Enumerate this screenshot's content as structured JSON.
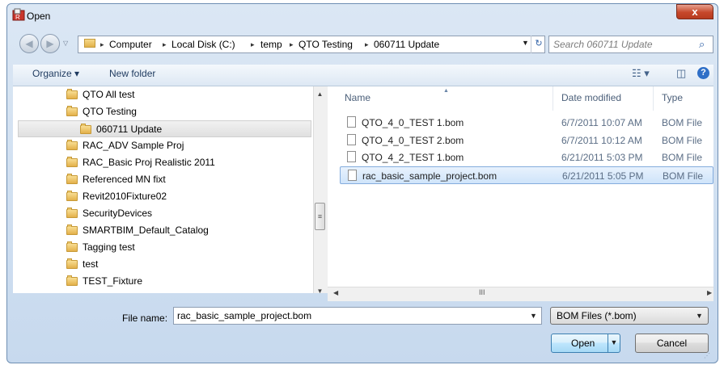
{
  "window": {
    "title": "Open",
    "close_label": "x"
  },
  "address": {
    "crumbs": [
      "Computer",
      "Local Disk (C:)",
      "temp",
      "QTO Testing",
      "060711 Update"
    ],
    "separator": "▸"
  },
  "search": {
    "placeholder": "Search 060711 Update"
  },
  "toolbar": {
    "organize": "Organize ▾",
    "new_folder": "New folder"
  },
  "tree": {
    "items": [
      {
        "label": "QTO All test",
        "selected": false
      },
      {
        "label": "QTO Testing",
        "selected": false
      },
      {
        "label": "060711 Update",
        "selected": true
      },
      {
        "label": "RAC_ADV Sample Proj",
        "selected": false
      },
      {
        "label": "RAC_Basic Proj Realistic 2011",
        "selected": false
      },
      {
        "label": "Referenced MN fixt",
        "selected": false
      },
      {
        "label": "Revit2010Fixture02",
        "selected": false
      },
      {
        "label": "SecurityDevices",
        "selected": false
      },
      {
        "label": "SMARTBIM_Default_Catalog",
        "selected": false
      },
      {
        "label": "Tagging test",
        "selected": false
      },
      {
        "label": "test",
        "selected": false
      },
      {
        "label": "TEST_Fixture",
        "selected": false
      }
    ]
  },
  "files": {
    "columns": {
      "name": "Name",
      "date": "Date modified",
      "type": "Type"
    },
    "rows": [
      {
        "name": "QTO_4_0_TEST 1.bom",
        "date": "6/7/2011 10:07 AM",
        "type": "BOM File"
      },
      {
        "name": "QTO_4_0_TEST 2.bom",
        "date": "6/7/2011 10:12 AM",
        "type": "BOM File"
      },
      {
        "name": "QTO_4_2_TEST 1.bom",
        "date": "6/21/2011 5:03 PM",
        "type": "BOM File"
      },
      {
        "name": "rac_basic_sample_project.bom",
        "date": "6/21/2011 5:05 PM",
        "type": "BOM File"
      }
    ]
  },
  "bottom": {
    "file_name_label": "File name:",
    "file_name_value": "rac_basic_sample_project.bom",
    "file_type_value": "BOM Files (*.bom)",
    "open_label": "Open",
    "cancel_label": "Cancel"
  },
  "scroll": {
    "thumb_glyph": "≡",
    "hthumb_glyph": "III"
  }
}
